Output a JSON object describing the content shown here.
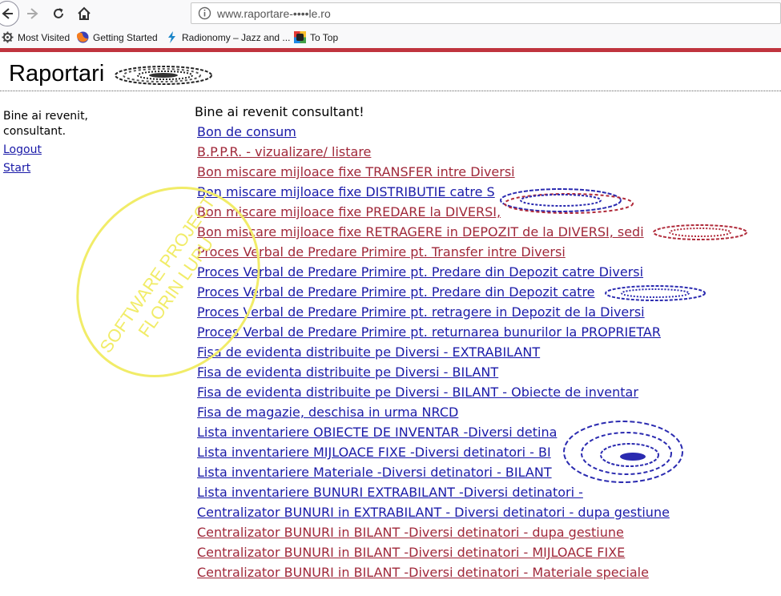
{
  "browser": {
    "url": "www.raportare-••••le.ro",
    "bookmarks": [
      {
        "label": "Most Visited",
        "icon": "gear-icon"
      },
      {
        "label": "Getting Started",
        "icon": "firefox-icon"
      },
      {
        "label": "Radionomy – Jazz and ...",
        "icon": "radionomy-icon"
      },
      {
        "label": "To Top",
        "icon": "to-top-icon"
      }
    ]
  },
  "header": {
    "title": "Raportari"
  },
  "sidebar": {
    "welcome": "Bine ai revenit, consultant.",
    "logout": "Logout",
    "start": "Start"
  },
  "main": {
    "greeting": "Bine ai revenit consultant!",
    "reports": [
      {
        "label": "Bon de consum",
        "color": "#1a1aa8"
      },
      {
        "label": "B.P.P.R. - vizualizare/ listare",
        "color": "#a0283a"
      },
      {
        "label": "Bon miscare mijloace fixe TRANSFER intre Diversi",
        "color": "#a0283a"
      },
      {
        "label": "Bon miscare mijloace fixe DISTRIBUTIE catre S",
        "color": "#1a1aa8"
      },
      {
        "label": "Bon miscare mijloace fixe PREDARE la DIVERSI,",
        "color": "#a0283a"
      },
      {
        "label": "Bon miscare mijloace fixe RETRAGERE in DEPOZIT de la DIVERSI, sedi",
        "color": "#a0283a"
      },
      {
        "label": "Proces Verbal de Predare Primire pt. Transfer intre Diversi",
        "color": "#a0283a"
      },
      {
        "label": "Proces Verbal de Predare Primire pt. Predare din Depozit catre Diversi",
        "color": "#1a1aa8"
      },
      {
        "label": "Proces Verbal de Predare Primire pt. Predare din Depozit catre",
        "color": "#1a1aa8"
      },
      {
        "label": "Proces Verbal de Predare Primire pt. retragere in Depozit de la Diversi",
        "color": "#1a1aa8"
      },
      {
        "label": "Proces Verbal de Predare Primire pt. returnarea bunurilor la PROPRIETAR",
        "color": "#1a1aa8"
      },
      {
        "label": "Fisa de evidenta distribuite pe Diversi - EXTRABILANT",
        "color": "#1a1aa8"
      },
      {
        "label": "Fisa de evidenta distribuite pe Diversi - BILANT",
        "color": "#1a1aa8"
      },
      {
        "label": "Fisa de evidenta distribuite pe Diversi - BILANT - Obiecte de inventar",
        "color": "#1a1aa8"
      },
      {
        "label": "Fisa de magazie, deschisa in urma NRCD",
        "color": "#1a1aa8"
      },
      {
        "label": "Lista inventariere OBIECTE DE INVENTAR -Diversi detina",
        "color": "#1a1aa8"
      },
      {
        "label": "Lista inventariere MIJLOACE FIXE -Diversi detinatori - BI",
        "color": "#1a1aa8"
      },
      {
        "label": "Lista inventariere Materiale -Diversi detinatori - BILANT",
        "color": "#1a1aa8"
      },
      {
        "label": "Lista inventariere BUNURI EXTRABILANT -Diversi detinatori -",
        "color": "#1a1aa8"
      },
      {
        "label": "Centralizator BUNURI in EXTRABILANT - Diversi detinatori - dupa gestiune",
        "color": "#1a1aa8"
      },
      {
        "label": "Centralizator BUNURI in BILANT -Diversi detinatori - dupa gestiune",
        "color": "#a0283a"
      },
      {
        "label": "Centralizator BUNURI in BILANT -Diversi detinatori - MIJLOACE FIXE",
        "color": "#a0283a"
      },
      {
        "label": "Centralizator BUNURI in BILANT -Diversi detinatori - Materiale speciale",
        "color": "#a0283a"
      }
    ]
  },
  "watermark": {
    "line1": "SOFTWARE PROJECT",
    "line2": "FLORIN LUPU"
  }
}
